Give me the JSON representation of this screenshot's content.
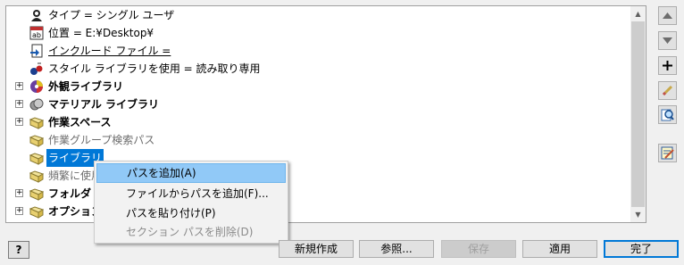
{
  "tree": {
    "rows": [
      {
        "label": "タイプ = シングル ユーザ",
        "icon": "user-type-icon",
        "expandable": false,
        "style": ""
      },
      {
        "label": "位置 = E:¥Desktop¥",
        "icon": "text-field-icon",
        "expandable": false,
        "style": ""
      },
      {
        "label": "インクルード ファイル =",
        "icon": "include-file-icon",
        "expandable": false,
        "style": "underline"
      },
      {
        "label": "スタイル ライブラリを使用 = 読み取り専用",
        "icon": "style-library-icon",
        "expandable": false,
        "style": ""
      },
      {
        "label": "外観ライブラリ",
        "icon": "appearance-library-icon",
        "expandable": true,
        "style": "bold"
      },
      {
        "label": "マテリアル ライブラリ",
        "icon": "material-library-icon",
        "expandable": true,
        "style": "bold"
      },
      {
        "label": "作業スペース",
        "icon": "folder-icon",
        "expandable": true,
        "style": "bold"
      },
      {
        "label": "作業グループ検索パス",
        "icon": "folder-icon",
        "expandable": false,
        "style": "gray"
      },
      {
        "label": "ライブラリ",
        "icon": "folder-icon",
        "expandable": false,
        "style": "selected"
      },
      {
        "label": "頻繁に使用",
        "icon": "folder-icon",
        "expandable": false,
        "style": "gray"
      },
      {
        "label": "フォルダ オ",
        "icon": "folder-icon",
        "expandable": true,
        "style": "bold"
      },
      {
        "label": "オプション",
        "icon": "folder-icon",
        "expandable": true,
        "style": "bold"
      }
    ]
  },
  "side_buttons": [
    {
      "name": "move-up-button",
      "icon": "triangle-up-icon"
    },
    {
      "name": "move-down-button",
      "icon": "triangle-down-icon"
    },
    {
      "name": "add-button",
      "icon": "plus-icon"
    },
    {
      "name": "edit-button",
      "icon": "pencil-icon"
    },
    {
      "name": "find-button",
      "icon": "magnifier-icon"
    },
    {
      "name": "edit-text-button",
      "icon": "notepad-icon"
    }
  ],
  "context_menu": {
    "items": [
      {
        "label": "パスを追加(A)",
        "state": "hover"
      },
      {
        "label": "ファイルからパスを追加(F)...",
        "state": "normal"
      },
      {
        "label": "パスを貼り付け(P)",
        "state": "normal"
      },
      {
        "label": "セクション パスを削除(D)",
        "state": "disabled"
      }
    ]
  },
  "buttons": {
    "help": "?",
    "new": "新規作成",
    "browse": "参照...",
    "save": "保存",
    "apply": "適用",
    "done": "完了"
  }
}
